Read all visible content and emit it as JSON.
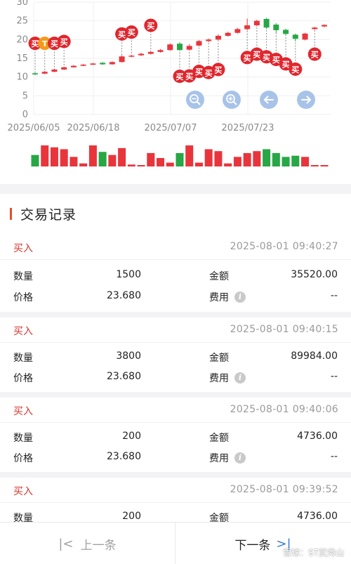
{
  "chart_data": {
    "type": "candlestick",
    "y_ticks": [
      "0",
      "5",
      "10",
      "15",
      "20",
      "25",
      "30"
    ],
    "x_ticks": [
      "2025/06/05",
      "2025/06/18",
      "2025/07/07",
      "2025/07/23"
    ],
    "ylim": [
      0,
      30
    ],
    "grid": true,
    "colors": {
      "up": "#e8353c",
      "down": "#27a745",
      "neutral": "#3a9ad9"
    },
    "candles": [
      {
        "o": 11.0,
        "c": 10.7,
        "h": 11.2,
        "l": 10.5,
        "v": 30
      },
      {
        "o": 10.9,
        "c": 11.4,
        "h": 11.6,
        "l": 10.8,
        "v": 55
      },
      {
        "o": 11.4,
        "c": 12.0,
        "h": 12.2,
        "l": 11.3,
        "v": 50
      },
      {
        "o": 12.0,
        "c": 12.6,
        "h": 12.8,
        "l": 11.9,
        "v": 45
      },
      {
        "o": 12.6,
        "c": 13.0,
        "h": 13.2,
        "l": 12.5,
        "v": 25
      },
      {
        "o": 13.0,
        "c": 13.3,
        "h": 13.5,
        "l": 12.9,
        "v": 8
      },
      {
        "o": 13.3,
        "c": 13.6,
        "h": 13.8,
        "l": 13.2,
        "v": 55
      },
      {
        "o": 13.8,
        "c": 13.4,
        "h": 14.0,
        "l": 13.2,
        "v": 38
      },
      {
        "o": 13.4,
        "c": 14.0,
        "h": 14.2,
        "l": 13.3,
        "v": 30
      },
      {
        "o": 14.0,
        "c": 15.5,
        "h": 15.8,
        "l": 13.9,
        "v": 48
      },
      {
        "o": 15.5,
        "c": 15.7,
        "h": 16.0,
        "l": 15.3,
        "v": 5
      },
      {
        "o": 15.8,
        "c": 16.2,
        "h": 16.5,
        "l": 15.6,
        "v": 3
      },
      {
        "o": 16.2,
        "c": 16.7,
        "h": 17.0,
        "l": 16.0,
        "v": 35
      },
      {
        "o": 16.7,
        "c": 17.2,
        "h": 17.5,
        "l": 16.5,
        "v": 22
      },
      {
        "o": 17.2,
        "c": 18.7,
        "h": 19.0,
        "l": 17.0,
        "v": 10
      },
      {
        "o": 18.9,
        "c": 17.2,
        "h": 19.3,
        "l": 17.0,
        "v": 35
      },
      {
        "o": 17.3,
        "c": 18.3,
        "h": 18.8,
        "l": 17.0,
        "v": 55
      },
      {
        "o": 18.4,
        "c": 19.6,
        "h": 19.9,
        "l": 18.2,
        "v": 10
      },
      {
        "o": 19.6,
        "c": 20.0,
        "h": 20.3,
        "l": 19.3,
        "v": 45
      },
      {
        "o": 20.0,
        "c": 21.0,
        "h": 21.4,
        "l": 19.8,
        "v": 40
      },
      {
        "o": 21.0,
        "c": 21.8,
        "h": 22.1,
        "l": 20.8,
        "v": 8
      },
      {
        "o": 21.8,
        "c": 22.8,
        "h": 23.1,
        "l": 21.6,
        "v": 25
      },
      {
        "o": 22.8,
        "c": 23.8,
        "h": 25.6,
        "l": 22.5,
        "v": 35
      },
      {
        "o": 23.8,
        "c": 25.0,
        "h": 25.3,
        "l": 23.5,
        "v": 40
      },
      {
        "o": 25.5,
        "c": 23.2,
        "h": 25.8,
        "l": 22.8,
        "v": 45
      },
      {
        "o": 24.0,
        "c": 22.5,
        "h": 24.4,
        "l": 21.8,
        "v": 35
      },
      {
        "o": 22.6,
        "c": 21.5,
        "h": 22.9,
        "l": 21.1,
        "v": 25
      },
      {
        "o": 21.3,
        "c": 20.2,
        "h": 21.6,
        "l": 19.5,
        "v": 28
      },
      {
        "o": 20.0,
        "c": 21.6,
        "h": 21.8,
        "l": 19.8,
        "v": 25
      },
      {
        "o": 22.8,
        "c": 23.2,
        "h": 23.4,
        "l": 22.6,
        "v": 3
      },
      {
        "o": 23.5,
        "c": 23.9,
        "h": 24.1,
        "l": 23.3,
        "v": 3
      }
    ],
    "buy_markers": [
      {
        "i": 0,
        "y": 19.0,
        "label": "买"
      },
      {
        "i": 1,
        "y": 19.0,
        "label": "T"
      },
      {
        "i": 2,
        "y": 19.0,
        "label": "买"
      },
      {
        "i": 3,
        "y": 19.5,
        "label": "买"
      },
      {
        "i": 9,
        "y": 21.5,
        "label": "买"
      },
      {
        "i": 10,
        "y": 22.0,
        "label": "买"
      },
      {
        "i": 12,
        "y": 23.8,
        "label": "买"
      },
      {
        "i": 15,
        "y": 10.2,
        "label": "买"
      },
      {
        "i": 16,
        "y": 10.3,
        "label": "买"
      },
      {
        "i": 17,
        "y": 11.5,
        "label": "买"
      },
      {
        "i": 18,
        "y": 11.2,
        "label": "买"
      },
      {
        "i": 19,
        "y": 12.0,
        "label": "买"
      },
      {
        "i": 22,
        "y": 15.2,
        "label": "买"
      },
      {
        "i": 23,
        "y": 16.1,
        "label": "买"
      },
      {
        "i": 24,
        "y": 15.4,
        "label": "买"
      },
      {
        "i": 25,
        "y": 14.7,
        "label": "买"
      },
      {
        "i": 26,
        "y": 13.5,
        "label": "买"
      },
      {
        "i": 27,
        "y": 12.1,
        "label": "买"
      },
      {
        "i": 29,
        "y": 16.1,
        "label": "买"
      }
    ],
    "marker_colors": {
      "buy": "#e0262d",
      "t": "#f39a1b"
    }
  },
  "chart_controls": [
    {
      "name": "zoom-out-button",
      "icon": "zoom-out-icon"
    },
    {
      "name": "zoom-in-button",
      "icon": "zoom-in-icon"
    },
    {
      "name": "scroll-left-button",
      "icon": "arrow-left-icon"
    },
    {
      "name": "scroll-right-button",
      "icon": "arrow-right-icon"
    }
  ],
  "section": {
    "title": "交易记录"
  },
  "labels": {
    "qty": "数量",
    "amount": "金额",
    "price": "价格",
    "fee": "费用",
    "info_icon": "i"
  },
  "records": [
    {
      "type": "买入",
      "time": "2025-08-01 09:40:27",
      "qty": "1500",
      "amount": "35520.00",
      "price": "23.680",
      "fee": "--"
    },
    {
      "type": "买入",
      "time": "2025-08-01 09:40:15",
      "qty": "3800",
      "amount": "89984.00",
      "price": "23.680",
      "fee": "--"
    },
    {
      "type": "买入",
      "time": "2025-08-01 09:40:06",
      "qty": "200",
      "amount": "4736.00",
      "price": "23.680",
      "fee": "--"
    },
    {
      "type": "买入",
      "time": "2025-08-01 09:39:52",
      "qty": "200",
      "amount": "4736.00"
    }
  ],
  "nav": {
    "prev_label": "上一条",
    "prev_icon": "|<",
    "next_label": "下一条",
    "next_icon": ">|"
  },
  "watermark": "雪球：ST武秀山"
}
